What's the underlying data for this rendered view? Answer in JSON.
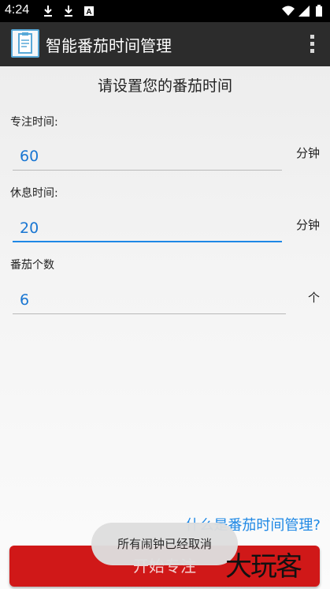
{
  "status_bar": {
    "time": "4:24",
    "icons": [
      "download-icon",
      "download-icon",
      "a-icon"
    ],
    "right_icons": [
      "wifi-icon",
      "signal-icon",
      "battery-icon"
    ]
  },
  "app_bar": {
    "title": "智能番茄时间管理",
    "logo": "clipboard-icon",
    "menu_icon": "overflow-menu-icon"
  },
  "main": {
    "heading": "请设置您的番茄时间",
    "focus": {
      "label": "专注时间:",
      "value": "60",
      "unit": "分钟"
    },
    "rest": {
      "label": "休息时间:",
      "value": "20",
      "unit": "分钟"
    },
    "count": {
      "label": "番茄个数",
      "value": "6",
      "unit": "个"
    },
    "help_link": "什么是番茄时间管理?",
    "start_button": "开始专注"
  },
  "toast": {
    "message": "所有闹钟已经取消"
  },
  "watermark": "大玩客",
  "colors": {
    "accent": "#1e88e5",
    "button": "#d01818",
    "app_bar": "#2c2c2c"
  }
}
